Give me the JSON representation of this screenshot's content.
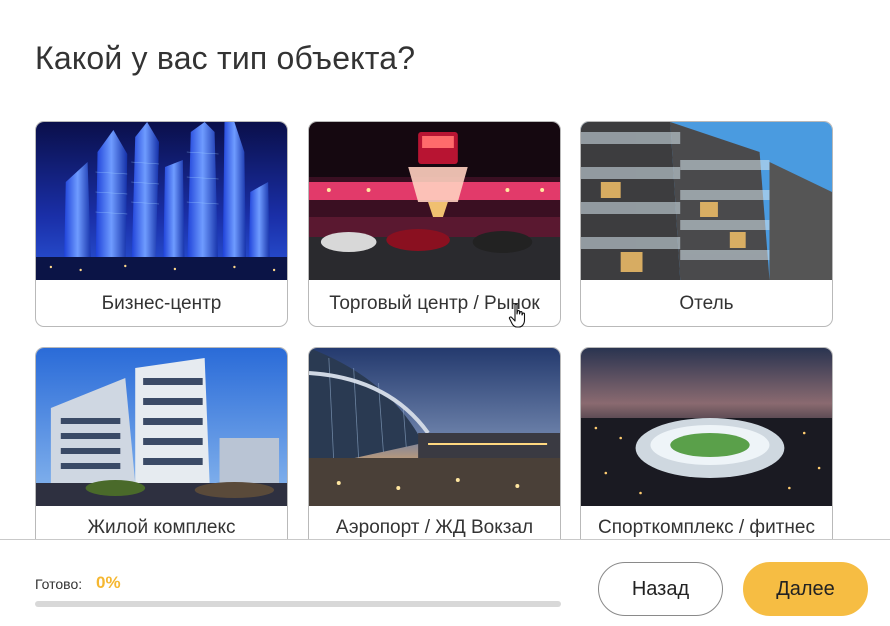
{
  "title": "Какой у вас тип объекта?",
  "options": [
    {
      "label": "Бизнес-центр",
      "image": "business-center-photo"
    },
    {
      "label": "Торговый центр / Рынок",
      "image": "shopping-center-photo",
      "hovered": true
    },
    {
      "label": "Отель",
      "image": "hotel-photo"
    },
    {
      "label": "Жилой комплекс",
      "image": "residential-complex-photo"
    },
    {
      "label": "Аэропорт / ЖД Вокзал",
      "image": "airport-photo"
    },
    {
      "label": "Спорткомплекс / фитнес",
      "image": "stadium-photo"
    }
  ],
  "footer": {
    "progress_label": "Готово:",
    "progress_value": "0%",
    "progress_fraction": 0,
    "back_label": "Назад",
    "next_label": "Далее"
  },
  "colors": {
    "accent": "#f6bd43",
    "progress_text": "#f5b731",
    "border": "#b9b9b9",
    "track": "#d8d8d8"
  }
}
